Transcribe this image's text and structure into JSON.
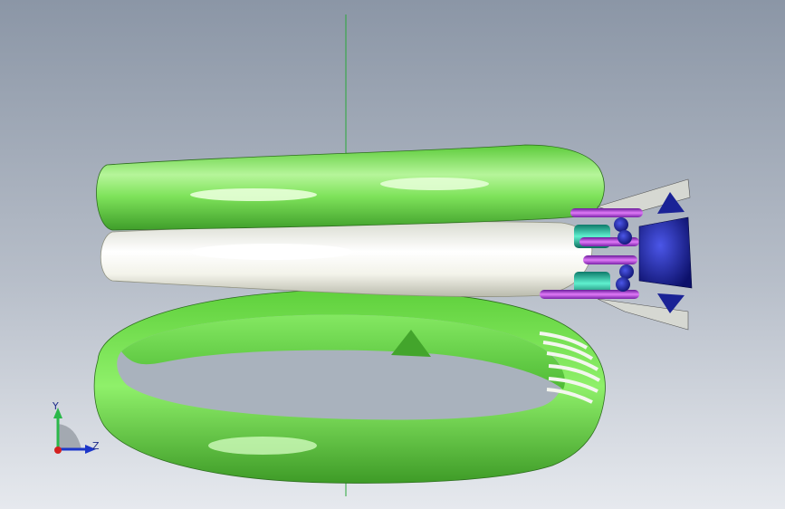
{
  "viewport": {
    "background_top": "#8b96a6",
    "background_bottom": "#e6e9ee"
  },
  "model": {
    "parts": [
      {
        "name": "upper-band",
        "color": "#7fe35b"
      },
      {
        "name": "middle-band",
        "color": "#f2f2ea"
      },
      {
        "name": "lower-ring",
        "color": "#79e04f"
      },
      {
        "name": "prong-settings",
        "color": "#9a30c8"
      },
      {
        "name": "gemstone-head",
        "color": "#151a8c"
      },
      {
        "name": "gallery-wires",
        "color": "#d8dcd4"
      }
    ],
    "axis_line_color": "#2aa83a"
  },
  "triad": {
    "y_label": "Y",
    "z_label": "Z",
    "y_color": "#2bb84a",
    "z_color": "#1c36c9",
    "x_color": "#d42020"
  }
}
